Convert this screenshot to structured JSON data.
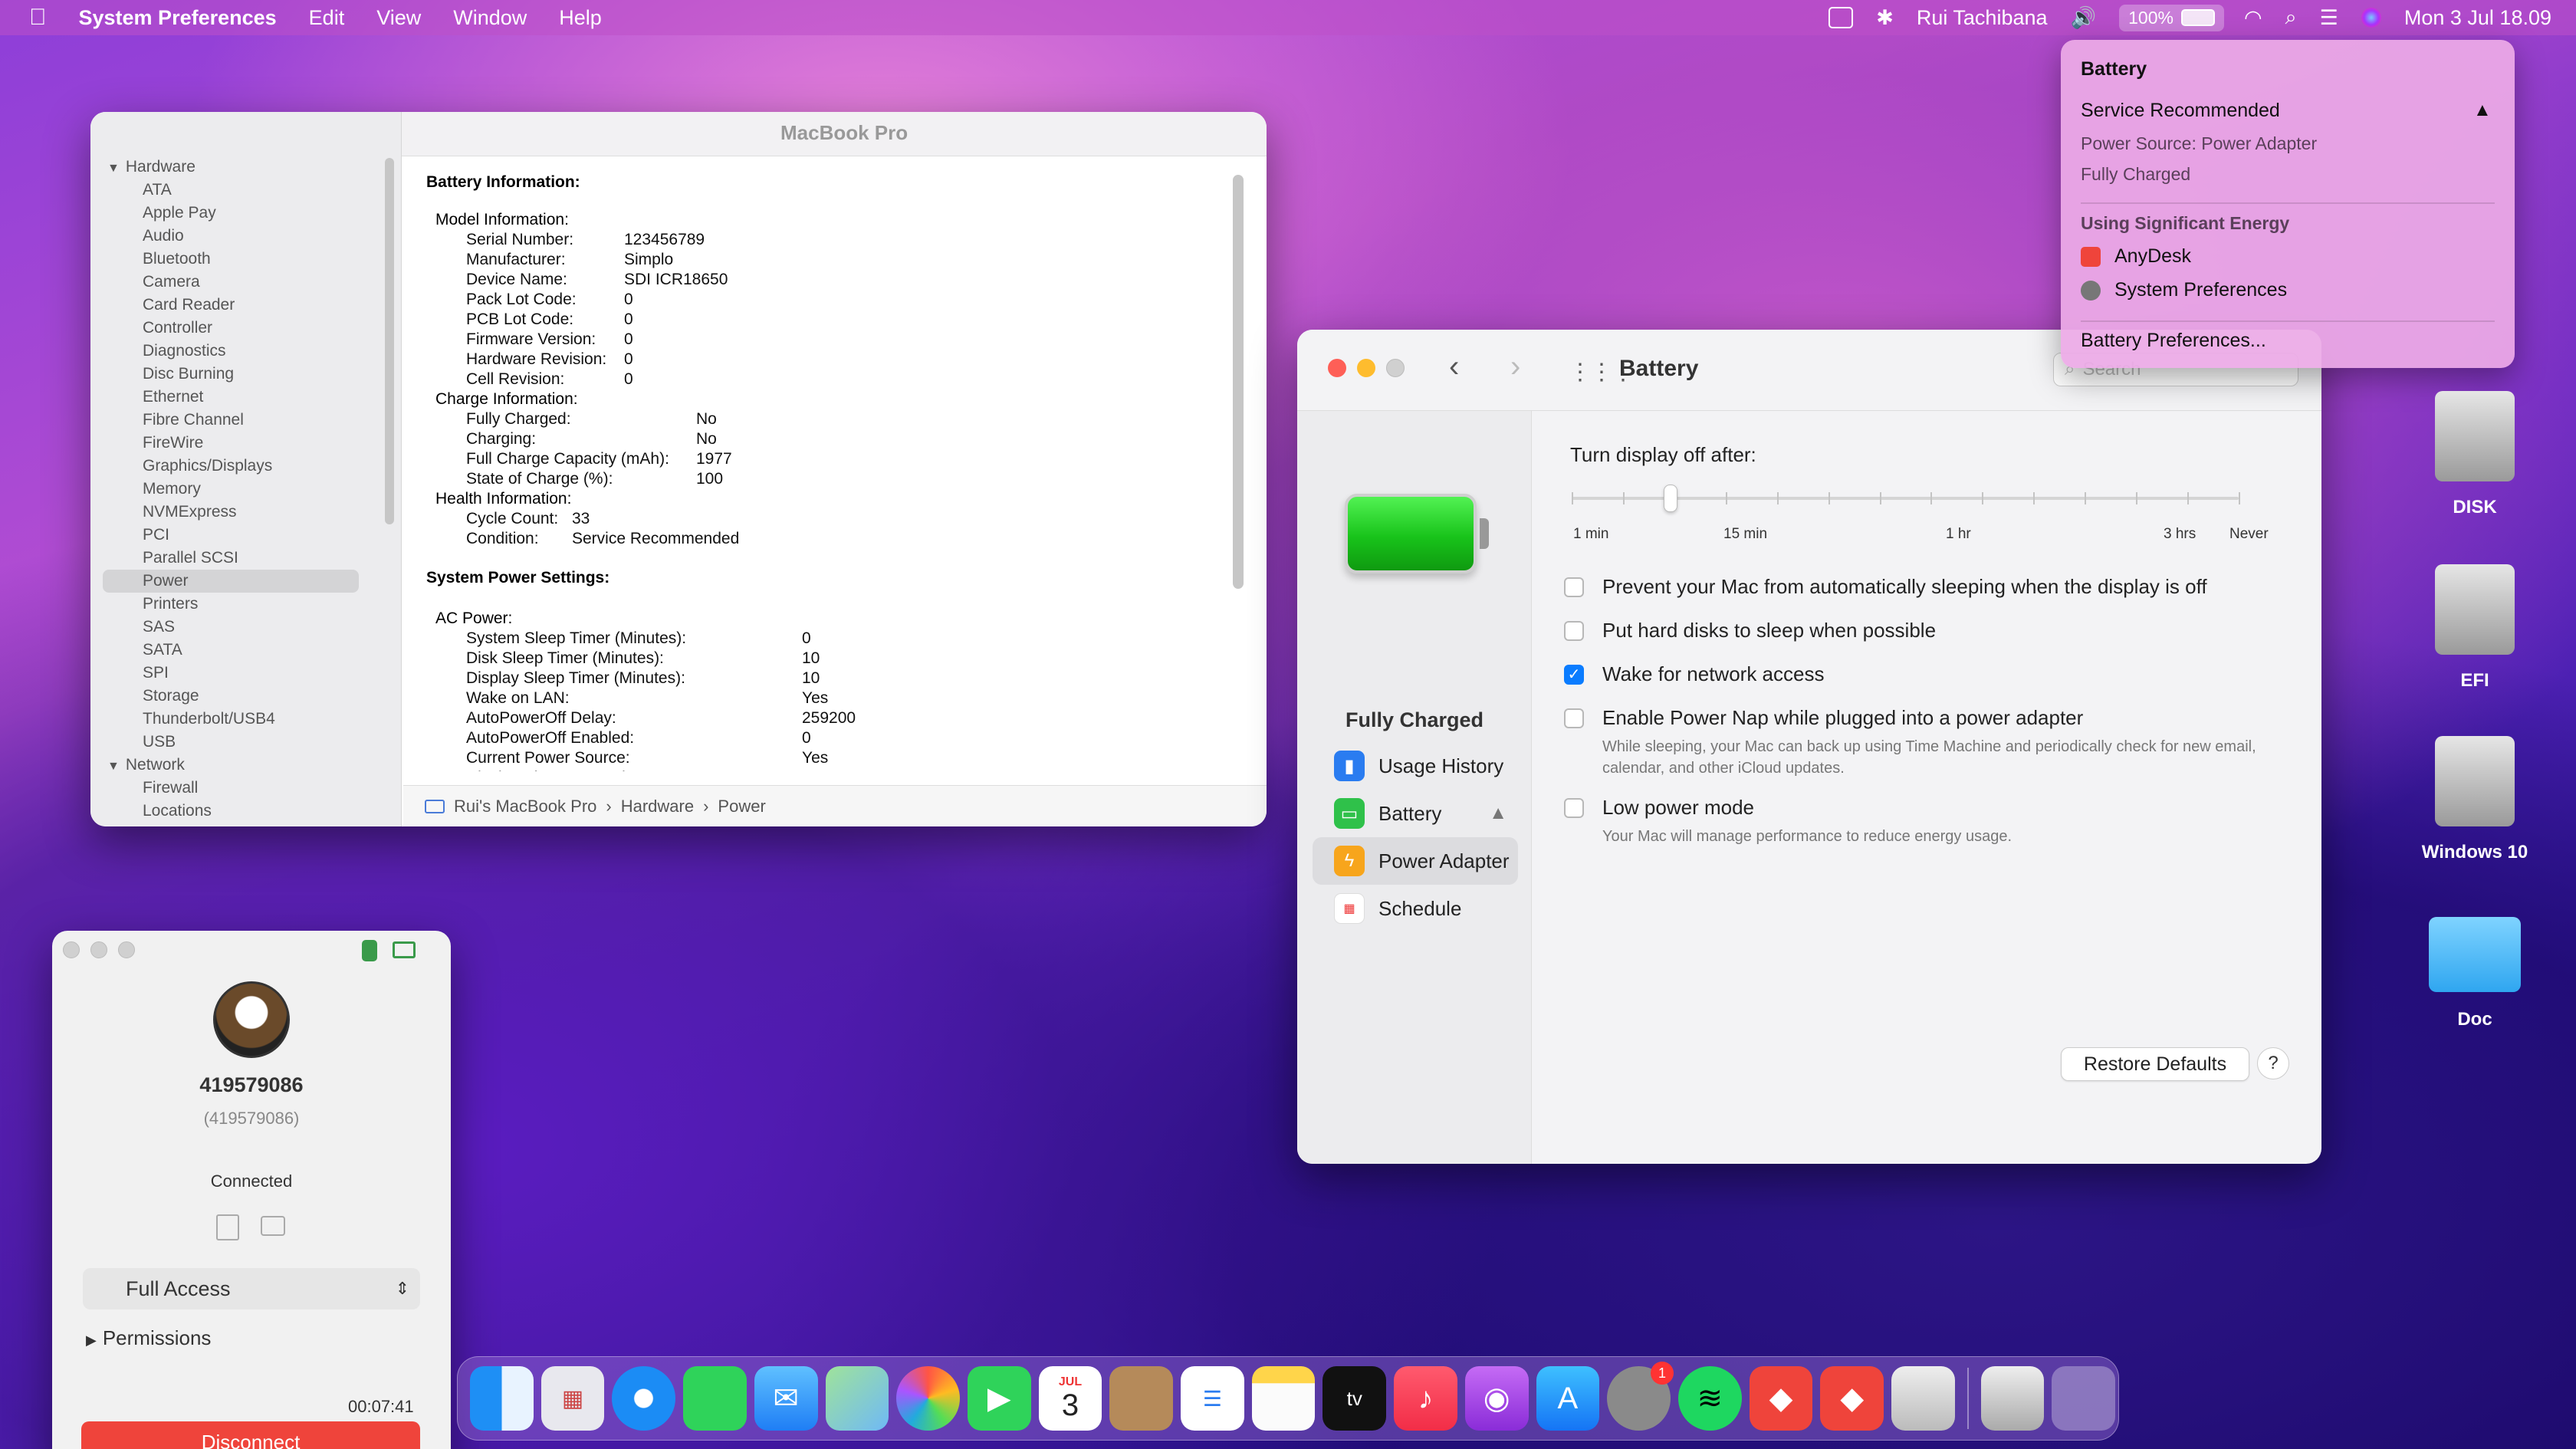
{
  "menubar": {
    "app": "System Preferences",
    "items": [
      "Edit",
      "View",
      "Window",
      "Help"
    ],
    "user": "Rui Tachibana",
    "battery_percent": "100%",
    "datetime": "Mon 3 Jul  18.09"
  },
  "battery_menu": {
    "title": "Battery",
    "status": "Service Recommended",
    "power_source": "Power Source: Power Adapter",
    "charge_state": "Fully Charged",
    "energy_header": "Using Significant Energy",
    "apps": [
      "AnyDesk",
      "System Preferences"
    ],
    "preferences": "Battery Preferences..."
  },
  "sysinfo": {
    "title": "MacBook Pro",
    "sidebar": {
      "hardware_label": "Hardware",
      "hardware_items": [
        "ATA",
        "Apple Pay",
        "Audio",
        "Bluetooth",
        "Camera",
        "Card Reader",
        "Controller",
        "Diagnostics",
        "Disc Burning",
        "Ethernet",
        "Fibre Channel",
        "FireWire",
        "Graphics/Displays",
        "Memory",
        "NVMExpress",
        "PCI",
        "Parallel SCSI",
        "Power",
        "Printers",
        "SAS",
        "SATA",
        "SPI",
        "Storage",
        "Thunderbolt/USB4",
        "USB"
      ],
      "network_label": "Network",
      "network_items": [
        "Firewall",
        "Locations"
      ]
    },
    "battery_info_title": "Battery Information:",
    "model_info": "Model Information:",
    "model_rows": [
      [
        "Serial Number:",
        "123456789"
      ],
      [
        "Manufacturer:",
        "Simplo"
      ],
      [
        "Device Name:",
        "SDI ICR18650"
      ],
      [
        "Pack Lot Code:",
        "0"
      ],
      [
        "PCB Lot Code:",
        "0"
      ],
      [
        "Firmware Version:",
        "0"
      ],
      [
        "Hardware Revision:",
        "0"
      ],
      [
        "Cell Revision:",
        "0"
      ]
    ],
    "charge_info": "Charge Information:",
    "charge_rows": [
      [
        "Fully Charged:",
        "No"
      ],
      [
        "Charging:",
        "No"
      ],
      [
        "Full Charge Capacity (mAh):",
        "1977"
      ],
      [
        "State of Charge (%):",
        "100"
      ]
    ],
    "health_info": "Health Information:",
    "health_rows": [
      [
        "Cycle Count:",
        "33"
      ],
      [
        "Condition:",
        "Service Recommended"
      ]
    ],
    "power_settings_title": "System Power Settings:",
    "ac_power": "AC Power:",
    "ac_rows": [
      [
        "System Sleep Timer (Minutes):",
        "0"
      ],
      [
        "Disk Sleep Timer (Minutes):",
        "10"
      ],
      [
        "Display Sleep Timer (Minutes):",
        "10"
      ],
      [
        "Wake on LAN:",
        "Yes"
      ],
      [
        "AutoPowerOff Delay:",
        "259200"
      ],
      [
        "AutoPowerOff Enabled:",
        "0"
      ],
      [
        "Current Power Source:",
        "Yes"
      ],
      [
        "Display Sleep Uses Dim:",
        "Yes"
      ]
    ],
    "path": [
      "Rui's MacBook Pro",
      "Hardware",
      "Power"
    ]
  },
  "battery_prefs": {
    "title": "Battery",
    "search_placeholder": "Search",
    "status": "Fully Charged",
    "nav": [
      "Usage History",
      "Battery",
      "Power Adapter",
      "Schedule"
    ],
    "selected_nav": "Power Adapter",
    "turn_off_label": "Turn display off after:",
    "slider_labels": [
      "1 min",
      "15 min",
      "1 hr",
      "3 hrs",
      "Never"
    ],
    "slider_value_minutes": 10,
    "options": [
      {
        "label": "Prevent your Mac from automatically sleeping when the display is off",
        "checked": false,
        "desc": ""
      },
      {
        "label": "Put hard disks to sleep when possible",
        "checked": false,
        "desc": ""
      },
      {
        "label": "Wake for network access",
        "checked": true,
        "desc": ""
      },
      {
        "label": "Enable Power Nap while plugged into a power adapter",
        "checked": false,
        "desc": "While sleeping, your Mac can back up using Time Machine and periodically check for new email, calendar, and other iCloud updates."
      },
      {
        "label": "Low power mode",
        "checked": false,
        "desc": "Your Mac will manage performance to reduce energy usage."
      }
    ],
    "restore_label": "Restore Defaults",
    "help_label": "?"
  },
  "anydesk": {
    "id": "419579086",
    "id_paren": "(419579086)",
    "status": "Connected",
    "access": "Full Access",
    "permissions": "Permissions",
    "timer": "00:07:41",
    "disconnect": "Disconnect"
  },
  "desktop_icons": [
    "DISK",
    "EFI",
    "Windows 10",
    "Doc"
  ],
  "dock": {
    "calendar_month": "JUL",
    "calendar_day": "3",
    "settings_badge": "1"
  }
}
